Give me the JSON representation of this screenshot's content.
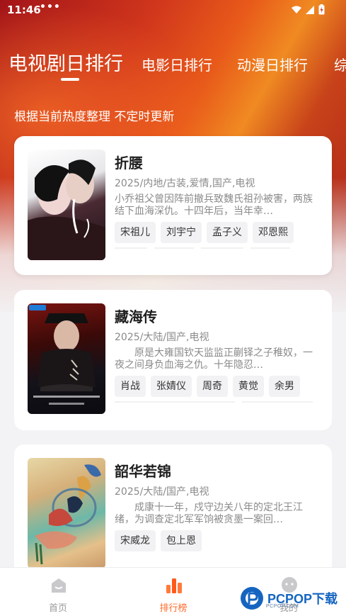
{
  "status_bar": {
    "time": "11:46",
    "dots": "•••"
  },
  "tabs": [
    {
      "label": "电视剧日排行",
      "active": true
    },
    {
      "label": "电影日排行",
      "active": false
    },
    {
      "label": "动漫日排行",
      "active": false
    },
    {
      "label": "综",
      "active": false
    }
  ],
  "subtitle": "根据当前热度整理 不定时更新",
  "cards": [
    {
      "title": "折腰",
      "meta": "2025/内地/古装,爱情,国产,电视",
      "desc": "小乔祖父曾因阵前撤兵致魏氏祖孙被害，两族结下血海深仇。十四年后，当年幸…",
      "cast": [
        "宋祖儿",
        "刘宇宁",
        "孟子义",
        "邓恩熙"
      ]
    },
    {
      "title": "藏海传",
      "meta": "2025/大陆/国产,电视",
      "desc": "原是大雍国钦天监监正蒯铎之子稚奴，一夜之间身负血海之仇。十年隐忍…",
      "cast": [
        "肖战",
        "张婧仪",
        "周奇",
        "黄觉",
        "余男"
      ],
      "poster_text": "藏海传",
      "poster_badge": "优酷全网独播 敬请期待"
    },
    {
      "title": "韶华若锦",
      "meta": "2025/大陆/国产,电视",
      "desc": "成康十一年，戍守边关八年的定北王江绪，为调查定北军军饷被贪墨一案回…",
      "cast": [
        "宋威龙",
        "包上恩"
      ]
    }
  ],
  "bottom_nav": [
    {
      "label": "首页",
      "icon": "home-icon"
    },
    {
      "label": "排行榜",
      "icon": "bar-chart-icon",
      "active": true
    },
    {
      "label": "我的",
      "icon": "profile-icon"
    }
  ],
  "watermark": {
    "text": "PCPOP下载",
    "sub": "PCPOP.COM"
  },
  "colors": {
    "accent": "#ff6a2a",
    "hero_red": "#c8301c",
    "hero_orange": "#f08a22"
  }
}
